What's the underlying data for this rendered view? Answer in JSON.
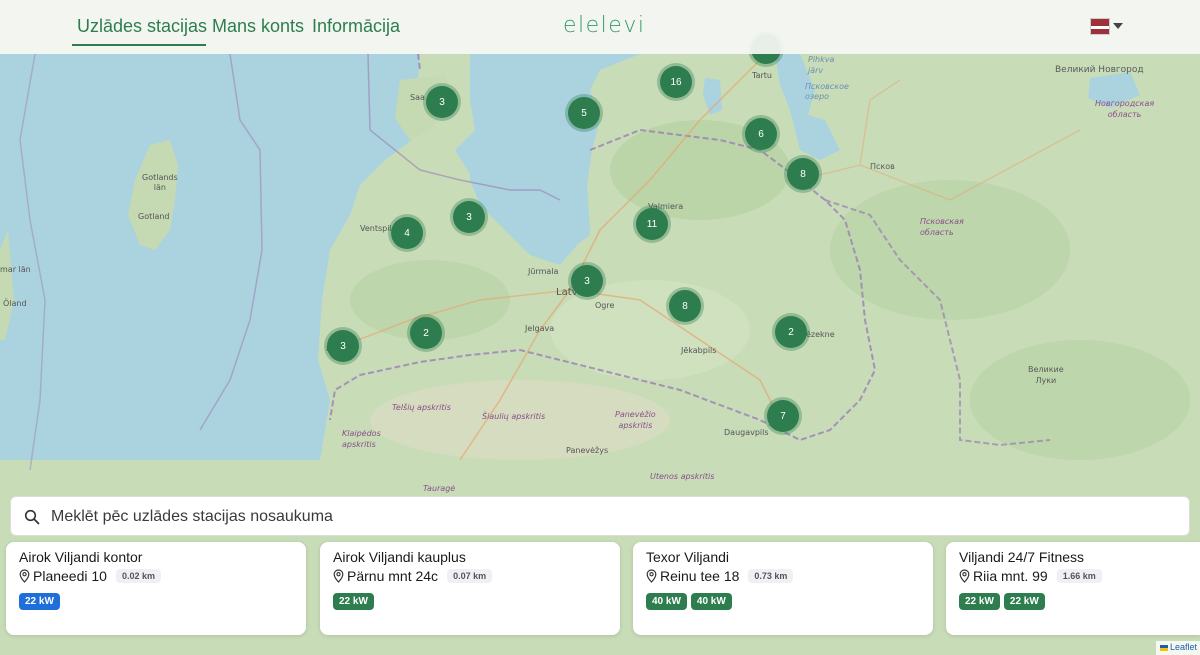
{
  "nav": {
    "items": [
      {
        "label": "Uzlādes stacijas",
        "active": true
      },
      {
        "label": "Mans konts",
        "active": false
      },
      {
        "label": "Informācija",
        "active": false
      }
    ],
    "logo": "elelevi",
    "language": {
      "code": "lv",
      "flag_colors": [
        "#9e3039",
        "#ffffff",
        "#9e3039"
      ]
    }
  },
  "map": {
    "clusters": [
      "3",
      "16",
      "5",
      "6",
      "8",
      "3",
      "4",
      "11",
      "3",
      "8",
      "2",
      "3",
      "2",
      "7"
    ],
    "place_labels": {
      "saaremaa": "Saa",
      "tartu": "Tartu",
      "pihkva": "Pihkva",
      "lake_text": "järv",
      "psk_lake": "Псковское\nозеро",
      "veliky_novgorod": "Великий Новгород",
      "novgorod_oblast": "Новгородская\nобласть",
      "pskov": "Псков",
      "pskov_oblast": "Псковская\nобласть",
      "gotlands_lan": "Gotlands\nlän",
      "gotland": "Gotland",
      "kalmar": "mar län",
      "oland": "Öland",
      "ventspils": "Ventspils",
      "valmiera": "Valmiera",
      "jurmala": "Jūrmala",
      "riga": "Latv",
      "ogre": "Ogre",
      "jelgava": "Jelgava",
      "jekabpils": "Jēkabpils",
      "rezekne": "ēzekne",
      "liepaja": "L",
      "velikie_luki": "Великие\nЛуки",
      "telsiu": "Telšių apskritis",
      "siauliu": "Šiaulių apskritis",
      "panevezio": "Panevėžio\napskritis",
      "klaipedos": "Klaipėdos\napskritis",
      "daugavpils": "Daugavpils",
      "panevezys": "Panevėžys",
      "utenos": "Utenos apskritis",
      "taurage": "Tauragė"
    }
  },
  "search": {
    "placeholder": "Meklēt pēc uzlādes stacijas nosaukuma",
    "value": ""
  },
  "stations": [
    {
      "name": "Airok Viljandi kontor",
      "address": "Planeedi 10",
      "distance": "0.02 km",
      "connectors": [
        {
          "label": "22 kW",
          "color": "#1e6fd9"
        }
      ]
    },
    {
      "name": "Airok Viljandi kauplus",
      "address": "Pärnu mnt 24c",
      "distance": "0.07 km",
      "connectors": [
        {
          "label": "22 kW",
          "color": "#2e7d4f"
        }
      ]
    },
    {
      "name": "Texor Viljandi",
      "address": "Reinu tee 18",
      "distance": "0.73 km",
      "connectors": [
        {
          "label": "40 kW",
          "color": "#2e7d4f"
        },
        {
          "label": "40 kW",
          "color": "#2e7d4f"
        }
      ]
    },
    {
      "name": "Viljandi 24/7 Fitness",
      "address": "Riia mnt. 99",
      "distance": "1.66 km",
      "connectors": [
        {
          "label": "22 kW",
          "color": "#2e7d4f"
        },
        {
          "label": "22 kW",
          "color": "#2e7d4f"
        }
      ]
    }
  ],
  "attribution": {
    "label": "Leaflet",
    "flag_colors": [
      "#1f5da8",
      "#f2c200"
    ]
  }
}
